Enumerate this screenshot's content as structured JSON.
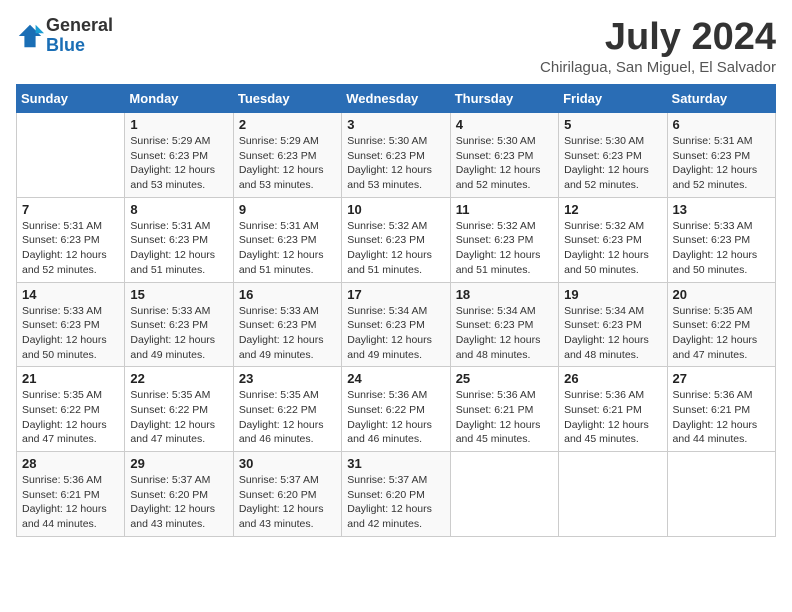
{
  "logo": {
    "general": "General",
    "blue": "Blue"
  },
  "title": "July 2024",
  "subtitle": "Chirilagua, San Miguel, El Salvador",
  "days_header": [
    "Sunday",
    "Monday",
    "Tuesday",
    "Wednesday",
    "Thursday",
    "Friday",
    "Saturday"
  ],
  "weeks": [
    [
      {
        "day": "",
        "info": ""
      },
      {
        "day": "1",
        "info": "Sunrise: 5:29 AM\nSunset: 6:23 PM\nDaylight: 12 hours\nand 53 minutes."
      },
      {
        "day": "2",
        "info": "Sunrise: 5:29 AM\nSunset: 6:23 PM\nDaylight: 12 hours\nand 53 minutes."
      },
      {
        "day": "3",
        "info": "Sunrise: 5:30 AM\nSunset: 6:23 PM\nDaylight: 12 hours\nand 53 minutes."
      },
      {
        "day": "4",
        "info": "Sunrise: 5:30 AM\nSunset: 6:23 PM\nDaylight: 12 hours\nand 52 minutes."
      },
      {
        "day": "5",
        "info": "Sunrise: 5:30 AM\nSunset: 6:23 PM\nDaylight: 12 hours\nand 52 minutes."
      },
      {
        "day": "6",
        "info": "Sunrise: 5:31 AM\nSunset: 6:23 PM\nDaylight: 12 hours\nand 52 minutes."
      }
    ],
    [
      {
        "day": "7",
        "info": "Sunrise: 5:31 AM\nSunset: 6:23 PM\nDaylight: 12 hours\nand 52 minutes."
      },
      {
        "day": "8",
        "info": "Sunrise: 5:31 AM\nSunset: 6:23 PM\nDaylight: 12 hours\nand 51 minutes."
      },
      {
        "day": "9",
        "info": "Sunrise: 5:31 AM\nSunset: 6:23 PM\nDaylight: 12 hours\nand 51 minutes."
      },
      {
        "day": "10",
        "info": "Sunrise: 5:32 AM\nSunset: 6:23 PM\nDaylight: 12 hours\nand 51 minutes."
      },
      {
        "day": "11",
        "info": "Sunrise: 5:32 AM\nSunset: 6:23 PM\nDaylight: 12 hours\nand 51 minutes."
      },
      {
        "day": "12",
        "info": "Sunrise: 5:32 AM\nSunset: 6:23 PM\nDaylight: 12 hours\nand 50 minutes."
      },
      {
        "day": "13",
        "info": "Sunrise: 5:33 AM\nSunset: 6:23 PM\nDaylight: 12 hours\nand 50 minutes."
      }
    ],
    [
      {
        "day": "14",
        "info": "Sunrise: 5:33 AM\nSunset: 6:23 PM\nDaylight: 12 hours\nand 50 minutes."
      },
      {
        "day": "15",
        "info": "Sunrise: 5:33 AM\nSunset: 6:23 PM\nDaylight: 12 hours\nand 49 minutes."
      },
      {
        "day": "16",
        "info": "Sunrise: 5:33 AM\nSunset: 6:23 PM\nDaylight: 12 hours\nand 49 minutes."
      },
      {
        "day": "17",
        "info": "Sunrise: 5:34 AM\nSunset: 6:23 PM\nDaylight: 12 hours\nand 49 minutes."
      },
      {
        "day": "18",
        "info": "Sunrise: 5:34 AM\nSunset: 6:23 PM\nDaylight: 12 hours\nand 48 minutes."
      },
      {
        "day": "19",
        "info": "Sunrise: 5:34 AM\nSunset: 6:23 PM\nDaylight: 12 hours\nand 48 minutes."
      },
      {
        "day": "20",
        "info": "Sunrise: 5:35 AM\nSunset: 6:22 PM\nDaylight: 12 hours\nand 47 minutes."
      }
    ],
    [
      {
        "day": "21",
        "info": "Sunrise: 5:35 AM\nSunset: 6:22 PM\nDaylight: 12 hours\nand 47 minutes."
      },
      {
        "day": "22",
        "info": "Sunrise: 5:35 AM\nSunset: 6:22 PM\nDaylight: 12 hours\nand 47 minutes."
      },
      {
        "day": "23",
        "info": "Sunrise: 5:35 AM\nSunset: 6:22 PM\nDaylight: 12 hours\nand 46 minutes."
      },
      {
        "day": "24",
        "info": "Sunrise: 5:36 AM\nSunset: 6:22 PM\nDaylight: 12 hours\nand 46 minutes."
      },
      {
        "day": "25",
        "info": "Sunrise: 5:36 AM\nSunset: 6:21 PM\nDaylight: 12 hours\nand 45 minutes."
      },
      {
        "day": "26",
        "info": "Sunrise: 5:36 AM\nSunset: 6:21 PM\nDaylight: 12 hours\nand 45 minutes."
      },
      {
        "day": "27",
        "info": "Sunrise: 5:36 AM\nSunset: 6:21 PM\nDaylight: 12 hours\nand 44 minutes."
      }
    ],
    [
      {
        "day": "28",
        "info": "Sunrise: 5:36 AM\nSunset: 6:21 PM\nDaylight: 12 hours\nand 44 minutes."
      },
      {
        "day": "29",
        "info": "Sunrise: 5:37 AM\nSunset: 6:20 PM\nDaylight: 12 hours\nand 43 minutes."
      },
      {
        "day": "30",
        "info": "Sunrise: 5:37 AM\nSunset: 6:20 PM\nDaylight: 12 hours\nand 43 minutes."
      },
      {
        "day": "31",
        "info": "Sunrise: 5:37 AM\nSunset: 6:20 PM\nDaylight: 12 hours\nand 42 minutes."
      },
      {
        "day": "",
        "info": ""
      },
      {
        "day": "",
        "info": ""
      },
      {
        "day": "",
        "info": ""
      }
    ]
  ]
}
